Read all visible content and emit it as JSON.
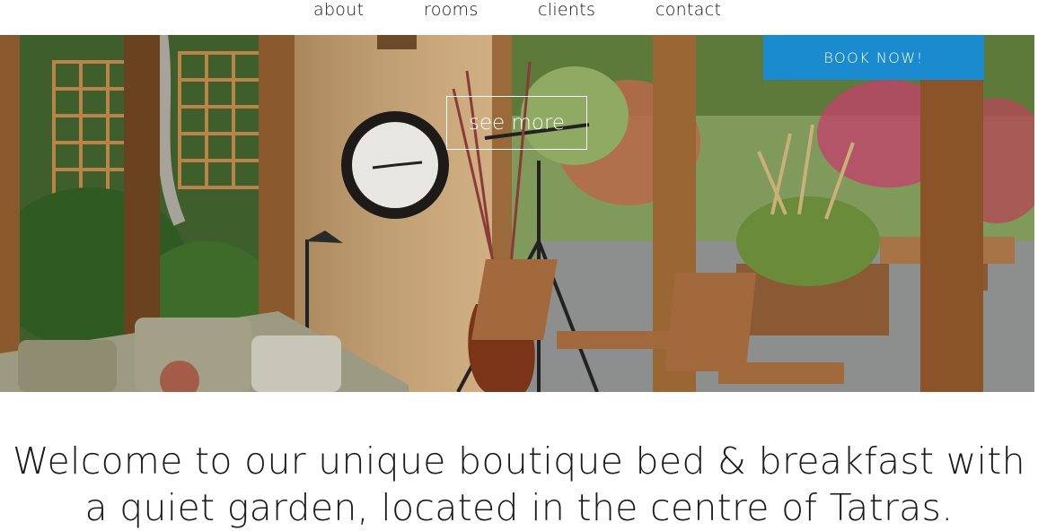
{
  "nav": {
    "items": [
      {
        "label": "about"
      },
      {
        "label": "rooms"
      },
      {
        "label": "clients"
      },
      {
        "label": "contact"
      }
    ]
  },
  "hero": {
    "book_label": "BOOK NOW!",
    "see_more_label": "see more",
    "accent_color": "#1b8bd0"
  },
  "main": {
    "headline": "Welcome to our unique boutique bed & breakfast with a quiet garden, located in the centre of Tatras."
  }
}
